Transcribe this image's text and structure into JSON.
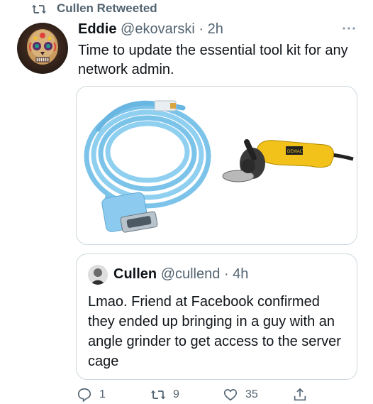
{
  "retweet": {
    "label": "Cullen Retweeted"
  },
  "tweet": {
    "name": "Eddie",
    "handle": "@ekovarski",
    "time": "· 2h",
    "text": "Time to update the essential tool kit for any network admin."
  },
  "media": {
    "left_icon": "console-cable-image",
    "right_icon": "angle-grinder-image",
    "grinder_brand": "DEWALT"
  },
  "quote": {
    "name": "Cullen",
    "handle": "@cullend",
    "time": "· 4h",
    "text": "Lmao. Friend at Facebook confirmed they ended up bringing in a guy with an angle grinder to get access to the server cage"
  },
  "actions": {
    "replies": "1",
    "retweets": "9",
    "likes": "35"
  },
  "colors": {
    "text": "#0f1419",
    "muted": "#536471",
    "border": "#cfd9de"
  }
}
